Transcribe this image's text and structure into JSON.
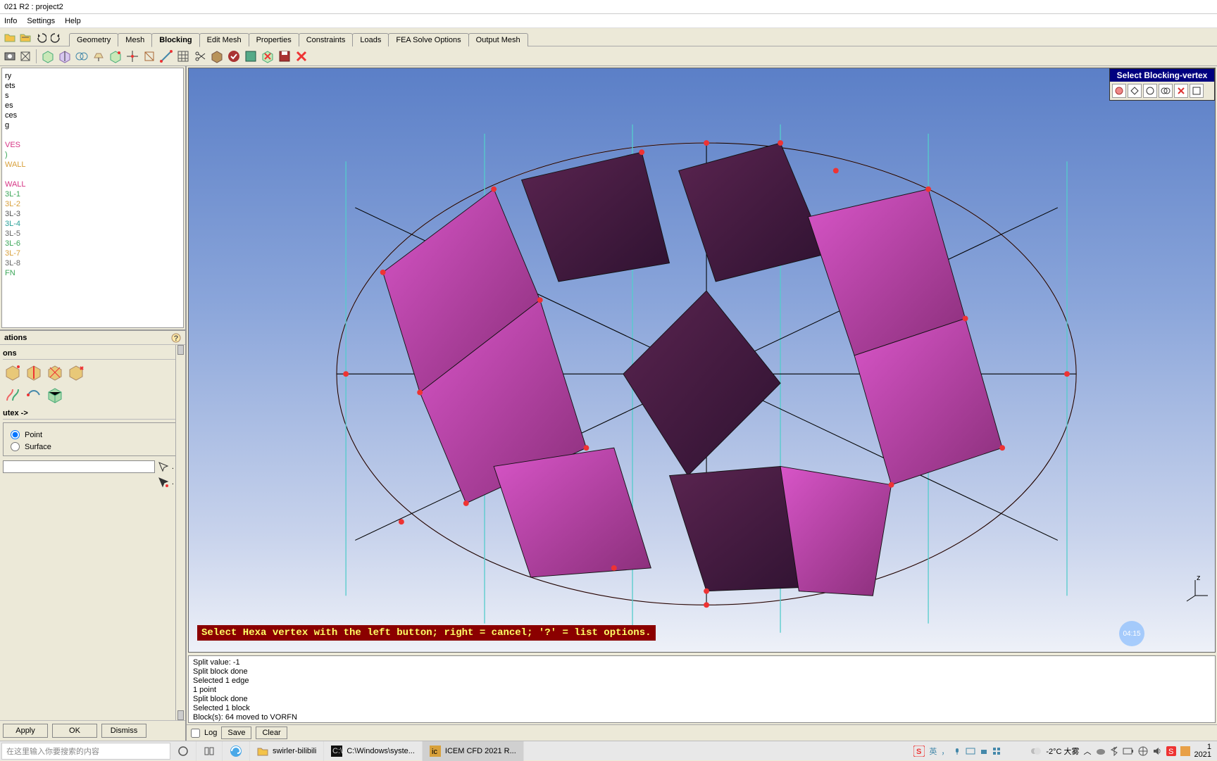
{
  "window": {
    "title": "021 R2 : project2"
  },
  "menu": [
    "Info",
    "Settings",
    "Help"
  ],
  "tabs": [
    "Geometry",
    "Mesh",
    "Blocking",
    "Edit Mesh",
    "Properties",
    "Constraints",
    "Loads",
    "FEA Solve Options",
    "Output Mesh"
  ],
  "active_tab": "Blocking",
  "tree": [
    {
      "label": "ry",
      "color": "#000"
    },
    {
      "label": "ets",
      "color": "#000"
    },
    {
      "label": "s",
      "color": "#000"
    },
    {
      "label": "es",
      "color": "#000"
    },
    {
      "label": "ces",
      "color": "#000"
    },
    {
      "label": "g",
      "color": "#000"
    },
    {
      "label": "",
      "color": "#000"
    },
    {
      "label": "VES",
      "color": "#d63384"
    },
    {
      "label": ")",
      "color": "#3aa657"
    },
    {
      "label": "WALL",
      "color": "#d8a03a"
    },
    {
      "label": "",
      "color": "#000"
    },
    {
      "label": "WALL",
      "color": "#d63384"
    },
    {
      "label": "3L-1",
      "color": "#3aa657"
    },
    {
      "label": "3L-2",
      "color": "#d8a03a"
    },
    {
      "label": "3L-3",
      "color": "#555"
    },
    {
      "label": "3L-4",
      "color": "#2aa198"
    },
    {
      "label": "3L-5",
      "color": "#666"
    },
    {
      "label": "3L-6",
      "color": "#3aa657"
    },
    {
      "label": "3L-7",
      "color": "#d8a03a"
    },
    {
      "label": "3L-8",
      "color": "#666"
    },
    {
      "label": "FN",
      "color": "#3aa657"
    }
  ],
  "ops": {
    "title": "ations",
    "sub": "ons",
    "section": "utex ->",
    "radio1": "Point",
    "radio2": "Surface",
    "apply": "Apply",
    "ok": "OK",
    "dismiss": "Dismiss"
  },
  "viewport": {
    "prompt": "Select Hexa vertex with the left button; right = cancel; '?' = list options.",
    "axis": "z",
    "floater": {
      "title": "Select Blocking-vertex"
    },
    "badge": "04:15"
  },
  "console": {
    "lines": [
      "Split value: -1",
      "Split block done",
      "Selected 1 edge",
      "1 point",
      "Split block done",
      "Selected 1 block",
      "Block(s): 64 moved to VORFN"
    ],
    "log": "Log",
    "save": "Save",
    "clear": "Clear"
  },
  "taskbar": {
    "search_placeholder": "在这里输入你要搜索的内容",
    "items": [
      {
        "label": "swirler-bilibili",
        "active": false
      },
      {
        "label": "C:\\Windows\\syste...",
        "active": false
      },
      {
        "label": "ICEM CFD 2021 R...",
        "active": true
      }
    ],
    "weather": "-2°C 大雾",
    "ime": "英",
    "time": "1",
    "date": "2021"
  }
}
